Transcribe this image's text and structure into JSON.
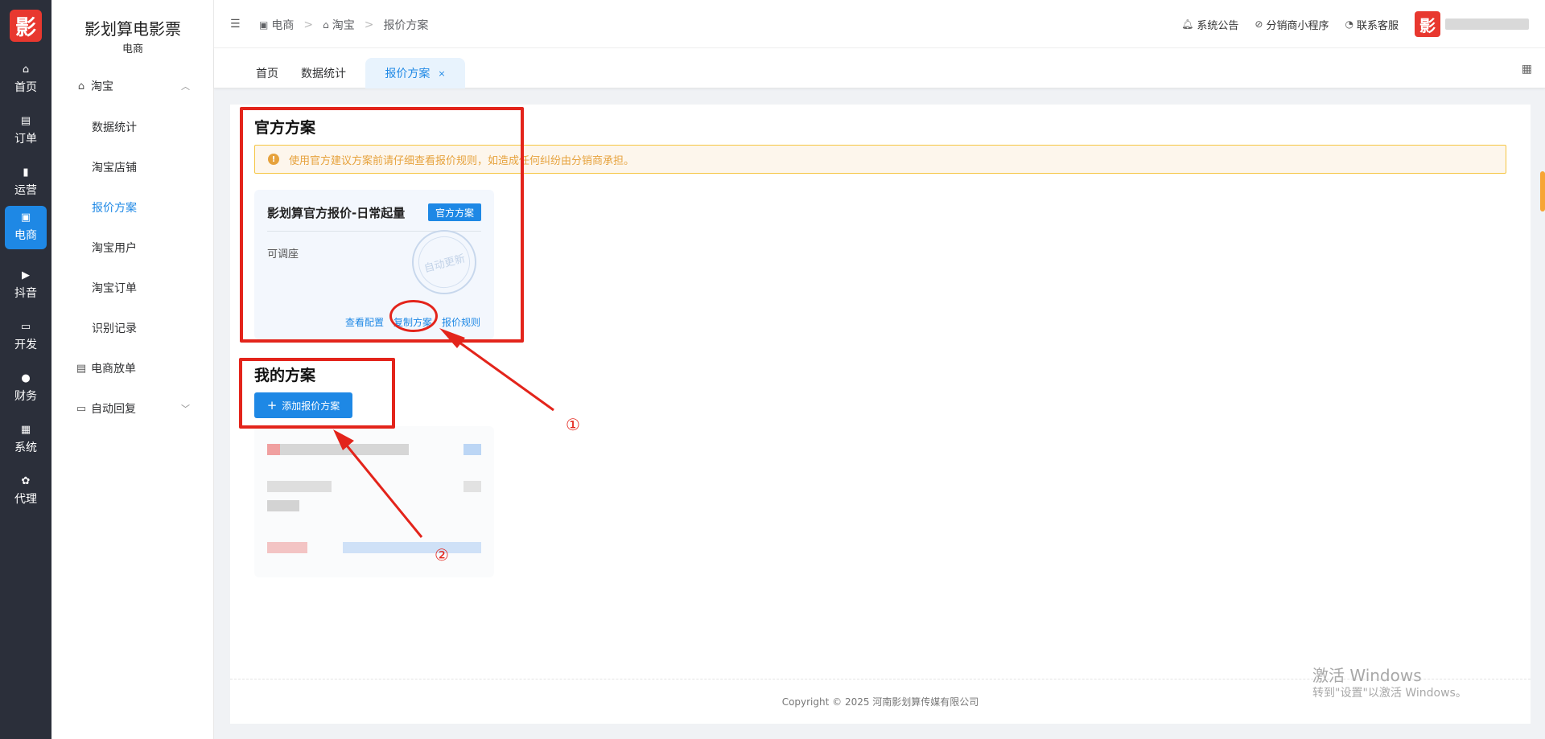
{
  "app": {
    "brand_title": "影划算电影票",
    "brand_sub": "电商",
    "logo_text": "影"
  },
  "rail": [
    {
      "label": "首页",
      "icon": "home-icon"
    },
    {
      "label": "订单",
      "icon": "order-icon"
    },
    {
      "label": "运营",
      "icon": "chart-icon"
    },
    {
      "label": "电商",
      "icon": "shop-icon",
      "active": true
    },
    {
      "label": "抖音",
      "icon": "video-icon"
    },
    {
      "label": "开发",
      "icon": "code-icon"
    },
    {
      "label": "财务",
      "icon": "yen-icon"
    },
    {
      "label": "系统",
      "icon": "apps-icon"
    },
    {
      "label": "代理",
      "icon": "agent-icon"
    }
  ],
  "sidebar": {
    "group_taobao": "淘宝",
    "items": [
      {
        "label": "数据统计"
      },
      {
        "label": "淘宝店铺"
      },
      {
        "label": "报价方案",
        "active": true
      },
      {
        "label": "淘宝用户"
      },
      {
        "label": "淘宝订单"
      },
      {
        "label": "识别记录"
      }
    ],
    "group_dispatch": "电商放单",
    "group_reply": "自动回复"
  },
  "header": {
    "breadcrumb": [
      "电商",
      "淘宝",
      "报价方案"
    ],
    "links": [
      "系统公告",
      "分销商小程序",
      "联系客服"
    ]
  },
  "tabs": [
    {
      "label": "首页"
    },
    {
      "label": "数据统计"
    },
    {
      "label": "报价方案",
      "active": true,
      "close": "×"
    }
  ],
  "official": {
    "title": "官方方案",
    "alert": "使用官方建议方案前请仔细查看报价规则，如造成任何纠纷由分销商承担。",
    "card": {
      "name": "影划算官方报价-日常起量",
      "badge": "官方方案",
      "desc": "可调座",
      "stamp": "自动更新",
      "actions": [
        "查看配置",
        "复制方案",
        "报价规则"
      ]
    }
  },
  "mine": {
    "title": "我的方案",
    "add_button": "添加报价方案"
  },
  "footer": {
    "text": "Copyright  ©  2025 河南影划算传媒有限公司"
  },
  "watermark": {
    "line1": "激活 Windows",
    "line2": "转到\"设置\"以激活 Windows。"
  },
  "annotations": {
    "step1": "①",
    "step2": "②",
    "color": "#e3241b"
  },
  "colors": {
    "primary": "#1e88e5",
    "rail_bg": "#2b2f3a",
    "warning": "#e6a23c"
  }
}
